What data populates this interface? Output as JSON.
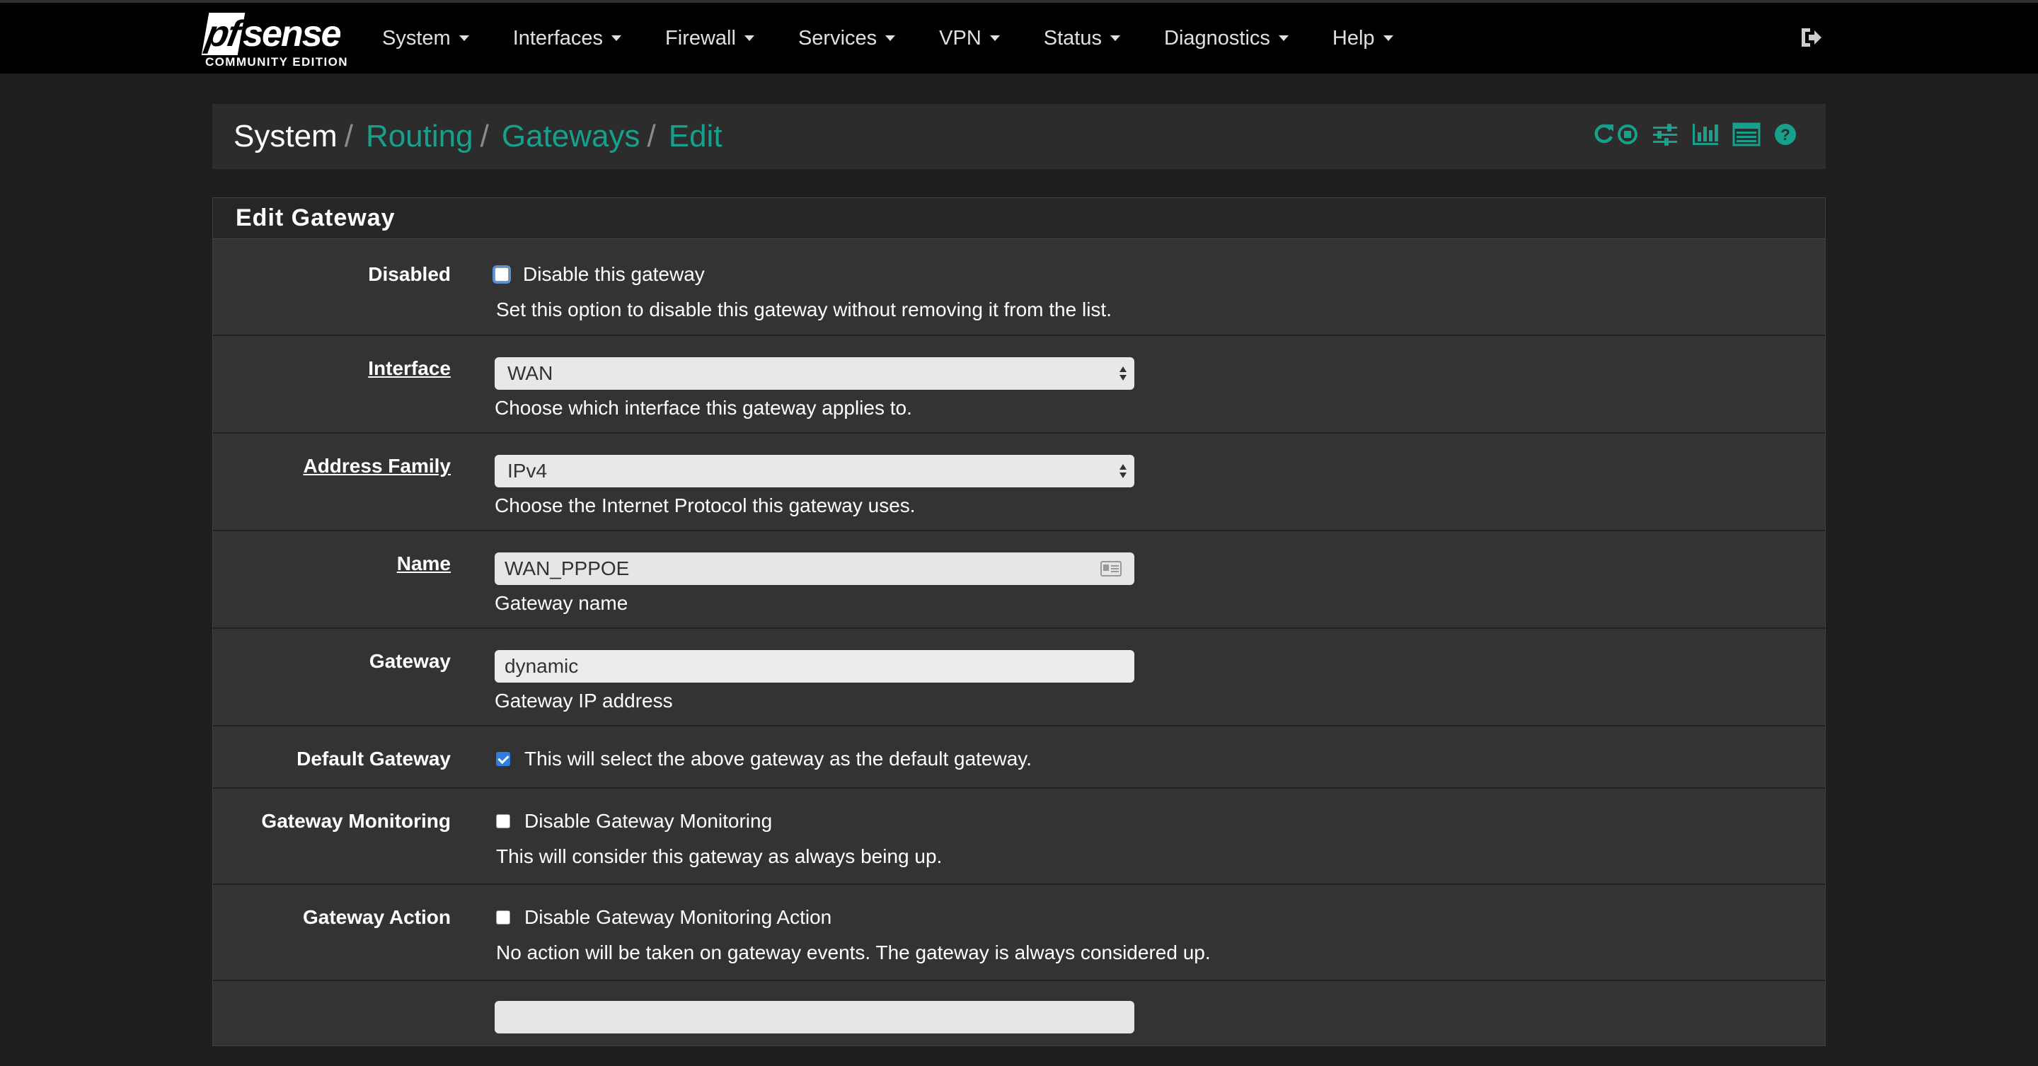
{
  "brand": {
    "logo_text": "pfsense",
    "edition": "COMMUNITY EDITION"
  },
  "nav": {
    "items": [
      {
        "label": "System"
      },
      {
        "label": "Interfaces"
      },
      {
        "label": "Firewall"
      },
      {
        "label": "Services"
      },
      {
        "label": "VPN"
      },
      {
        "label": "Status"
      },
      {
        "label": "Diagnostics"
      },
      {
        "label": "Help"
      }
    ]
  },
  "breadcrumb": {
    "items": [
      "System",
      "Routing",
      "Gateways",
      "Edit"
    ],
    "separator": "/",
    "link_color": "#17a08c"
  },
  "panel": {
    "title": "Edit Gateway"
  },
  "form": {
    "disabled": {
      "label": "Disabled",
      "checkbox_label": "Disable this gateway",
      "checked": false,
      "help": "Set this option to disable this gateway without removing it from the list."
    },
    "interface": {
      "label": "Interface",
      "selected": "WAN",
      "help": "Choose which interface this gateway applies to."
    },
    "address_family": {
      "label": "Address Family",
      "selected": "IPv4",
      "help": "Choose the Internet Protocol this gateway uses."
    },
    "name": {
      "label": "Name",
      "value": "WAN_PPPOE",
      "help": "Gateway name"
    },
    "gateway": {
      "label": "Gateway",
      "value": "dynamic",
      "help": "Gateway IP address"
    },
    "default_gateway": {
      "label": "Default Gateway",
      "checkbox_label": "This will select the above gateway as the default gateway.",
      "checked": true
    },
    "gateway_monitoring": {
      "label": "Gateway Monitoring",
      "checkbox_label": "Disable Gateway Monitoring",
      "checked": false,
      "help": "This will consider this gateway as always being up."
    },
    "gateway_action": {
      "label": "Gateway Action",
      "checkbox_label": "Disable Gateway Monitoring Action",
      "checked": false,
      "help": "No action will be taken on gateway events. The gateway is always considered up."
    }
  },
  "colors": {
    "topbar": "#000000",
    "background": "#1e1e1e",
    "panel": "#333333",
    "accent": "#17a08c",
    "checkbox_checked": "#2f7de1"
  }
}
